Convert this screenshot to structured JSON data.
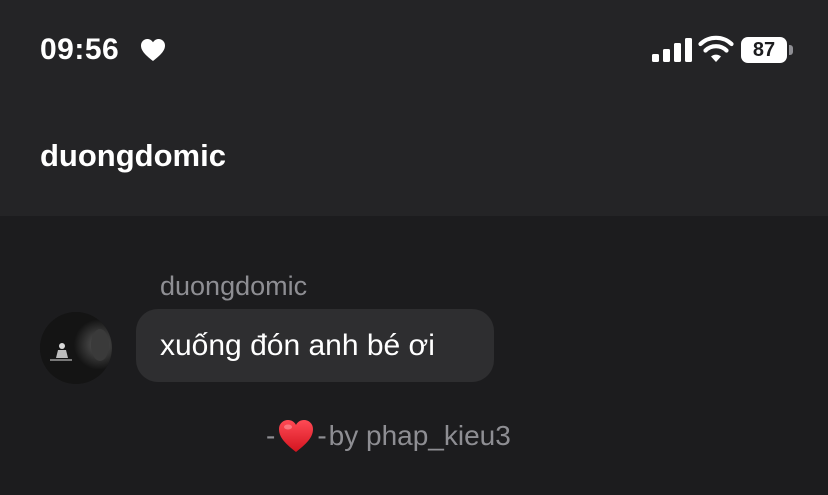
{
  "status_bar": {
    "time": "09:56",
    "status_icon": "heart-icon",
    "battery_level": "87",
    "icons": [
      "cellular-signal-icon",
      "wifi-icon",
      "battery-icon"
    ]
  },
  "header": {
    "title": "duongdomic"
  },
  "message": {
    "sender": "duongdomic",
    "text": "xuống đón anh bé ơi",
    "avatar_icon": "avatar"
  },
  "footer": {
    "dash_left": "-",
    "heart_icon": "red-heart-icon",
    "dash_right": "-",
    "credit_text": "by phap_kieu3"
  },
  "colors": {
    "background": "#1c1c1e",
    "header_background": "#242426",
    "bubble": "#2e2e30",
    "secondary_text": "#8e8e93",
    "heart": "#e0192a"
  }
}
